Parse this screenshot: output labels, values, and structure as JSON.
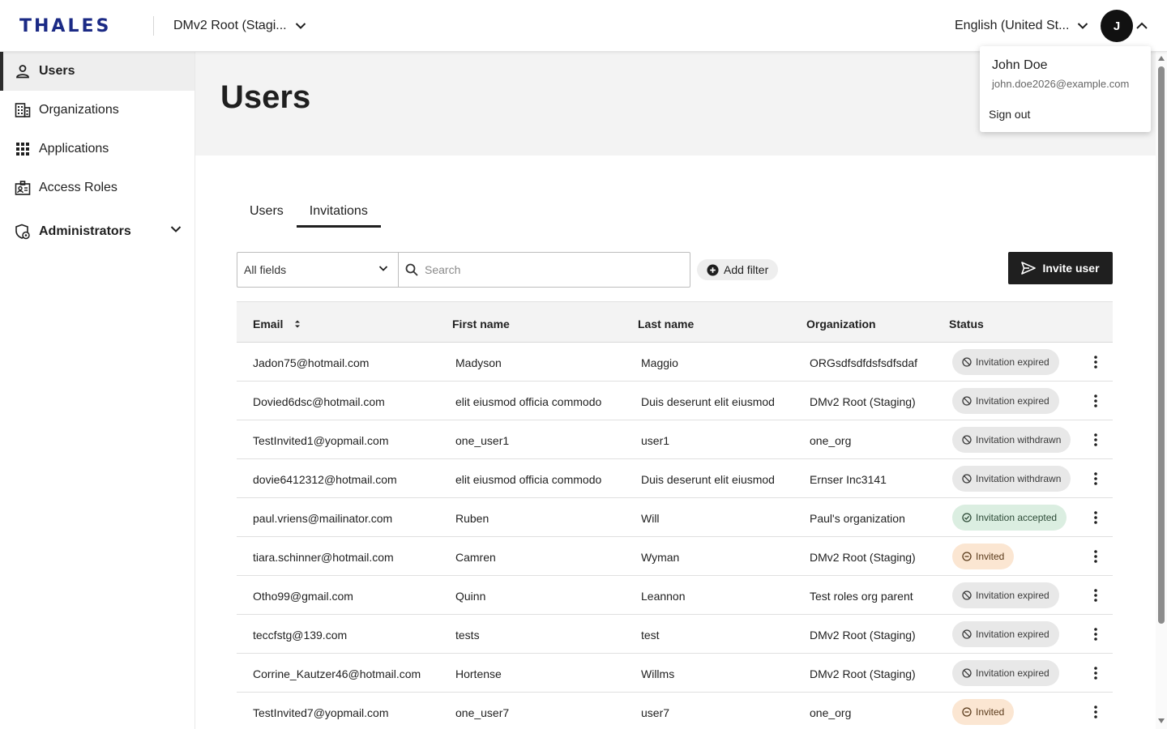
{
  "header": {
    "logo": "THALES",
    "org_selector": "DMv2 Root (Stagi...",
    "language_selector": "English (United St...",
    "avatar_initial": "J"
  },
  "user_menu": {
    "name": "John Doe",
    "email": "john.doe2026@example.com",
    "sign_out": "Sign out"
  },
  "sidebar": {
    "items": [
      {
        "label": "Users",
        "icon": "person-icon",
        "active": true
      },
      {
        "label": "Organizations",
        "icon": "building-icon"
      },
      {
        "label": "Applications",
        "icon": "grid-icon"
      },
      {
        "label": "Access Roles",
        "icon": "id-badge-icon"
      },
      {
        "label": "Administrators",
        "icon": "shield-gear-icon",
        "expandable": true
      }
    ]
  },
  "page": {
    "title": "Users",
    "tabs": [
      {
        "label": "Users"
      },
      {
        "label": "Invitations",
        "active": true
      }
    ]
  },
  "toolbar": {
    "field_select": "All fields",
    "search_placeholder": "Search",
    "add_filter": "Add filter",
    "invite_button": "Invite user"
  },
  "table": {
    "columns": [
      "Email",
      "First name",
      "Last name",
      "Organization",
      "Status"
    ],
    "rows": [
      {
        "email": "Jadon75@hotmail.com",
        "first": "Madyson",
        "last": "Maggio",
        "org": "ORGsdfsdfdsfsdfsdaf",
        "status": "Invitation expired",
        "kind": "neutral"
      },
      {
        "email": "Dovied6dsc@hotmail.com",
        "first": "elit eiusmod officia commodo",
        "last": "Duis deserunt elit eiusmod",
        "org": "DMv2 Root (Staging)",
        "status": "Invitation expired",
        "kind": "neutral"
      },
      {
        "email": "TestInvited1@yopmail.com",
        "first": "one_user1",
        "last": "user1",
        "org": "one_org",
        "status": "Invitation withdrawn",
        "kind": "neutral"
      },
      {
        "email": "dovie6412312@hotmail.com",
        "first": "elit eiusmod officia commodo",
        "last": "Duis deserunt elit eiusmod",
        "org": "Ernser Inc3141",
        "status": "Invitation withdrawn",
        "kind": "neutral"
      },
      {
        "email": "paul.vriens@mailinator.com",
        "first": "Ruben",
        "last": "Will",
        "org": "Paul's organization",
        "status": "Invitation accepted",
        "kind": "success"
      },
      {
        "email": "tiara.schinner@hotmail.com",
        "first": "Camren",
        "last": "Wyman",
        "org": "DMv2 Root (Staging)",
        "status": "Invited",
        "kind": "warn"
      },
      {
        "email": "Otho99@gmail.com",
        "first": "Quinn",
        "last": "Leannon",
        "org": "Test roles org parent",
        "status": "Invitation expired",
        "kind": "neutral"
      },
      {
        "email": "teccfstg@139.com",
        "first": "tests",
        "last": "test",
        "org": "DMv2 Root (Staging)",
        "status": "Invitation expired",
        "kind": "neutral"
      },
      {
        "email": "Corrine_Kautzer46@hotmail.com",
        "first": "Hortense",
        "last": "Willms",
        "org": "DMv2 Root (Staging)",
        "status": "Invitation expired",
        "kind": "neutral"
      },
      {
        "email": "TestInvited7@yopmail.com",
        "first": "one_user7",
        "last": "user7",
        "org": "one_org",
        "status": "Invited",
        "kind": "warn"
      }
    ]
  },
  "colors": {
    "brand": "#1b2a85",
    "dark": "#1f1f1f",
    "badge_neutral": "#e8e8e8",
    "badge_success": "#dbeee1",
    "badge_warn": "#fbe6d2"
  }
}
